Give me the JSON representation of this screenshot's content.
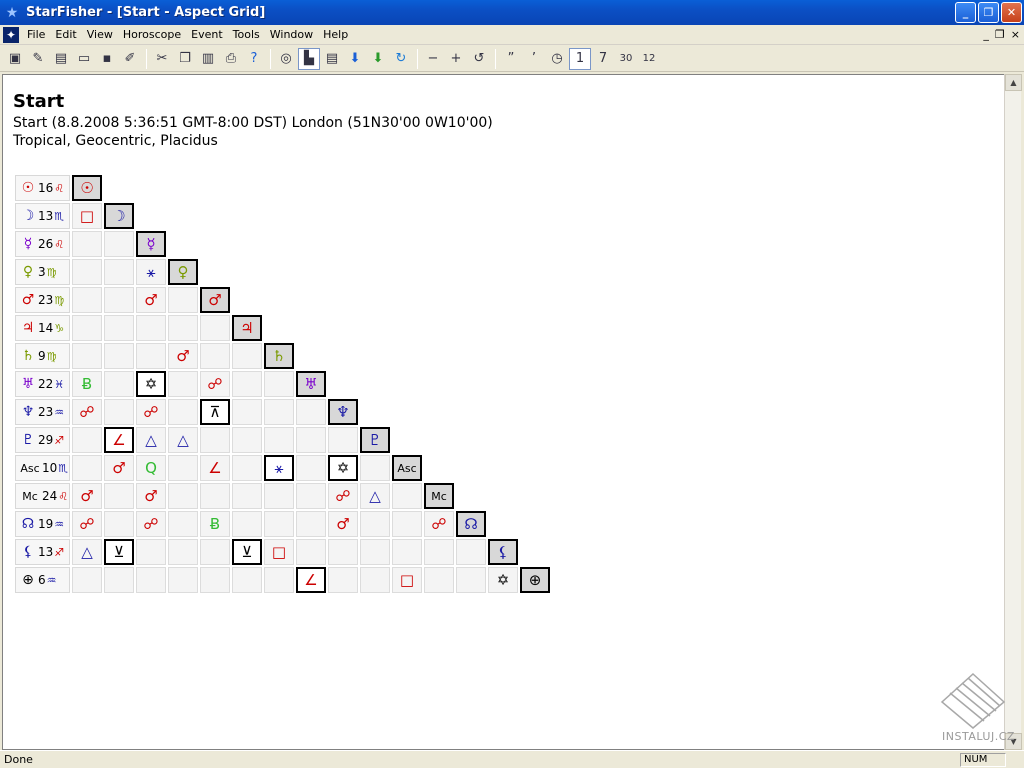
{
  "window": {
    "title": "StarFisher - [Start - Aspect Grid]",
    "app_icon": "star-icon",
    "buttons": {
      "minimize": "_",
      "maximize": "❐",
      "close": "✕"
    }
  },
  "menubar": {
    "items": [
      "File",
      "Edit",
      "View",
      "Horoscope",
      "Event",
      "Tools",
      "Window",
      "Help"
    ],
    "mdi_buttons": {
      "minimize": "_",
      "restore": "❐",
      "close": "×"
    }
  },
  "toolbar": {
    "groups": [
      [
        {
          "icon": "new-chart-icon",
          "glyph": "▣"
        },
        {
          "icon": "search-chart-icon",
          "glyph": "✎"
        },
        {
          "icon": "new-document-icon",
          "glyph": "▤"
        },
        {
          "icon": "open-folder-icon",
          "glyph": "▭"
        },
        {
          "icon": "save-icon",
          "glyph": "▪"
        },
        {
          "icon": "edit-icon",
          "glyph": "✐"
        }
      ],
      [
        {
          "icon": "cut-icon",
          "glyph": "✂"
        },
        {
          "icon": "copy-icon",
          "glyph": "❐"
        },
        {
          "icon": "paste-icon",
          "glyph": "▥"
        },
        {
          "icon": "print-icon",
          "glyph": "⎙"
        },
        {
          "icon": "help-icon",
          "glyph": "?"
        }
      ],
      [
        {
          "icon": "wheel-chart-icon",
          "glyph": "◎"
        },
        {
          "icon": "aspect-grid-icon",
          "glyph": "▙",
          "pressed": true
        },
        {
          "icon": "report-icon",
          "glyph": "▤"
        },
        {
          "icon": "arrow-down-blue-icon",
          "glyph": "⬇"
        },
        {
          "icon": "arrow-down-green-icon",
          "glyph": "⬇"
        },
        {
          "icon": "refresh-icon",
          "glyph": "↻"
        }
      ],
      [
        {
          "icon": "zoom-out-icon",
          "glyph": "−"
        },
        {
          "icon": "zoom-in-icon",
          "glyph": "+"
        },
        {
          "icon": "undo-icon",
          "glyph": "↺"
        }
      ],
      [
        {
          "icon": "step-back-icon",
          "glyph": "”"
        },
        {
          "icon": "step-forward-icon",
          "glyph": "’"
        },
        {
          "icon": "clock-icon",
          "glyph": "◷"
        },
        {
          "icon": "one-day-icon",
          "glyph": "1",
          "pressed": true
        },
        {
          "icon": "seven-days-icon",
          "glyph": "7"
        },
        {
          "icon": "thirty-days-icon",
          "glyph": "30"
        },
        {
          "icon": "twelve-months-icon",
          "glyph": "12"
        }
      ]
    ]
  },
  "header": {
    "title": "Start",
    "line1": "Start (8.8.2008 5:36:51 GMT-8:00 DST) London (51N30'00 0W10'00)",
    "line2": "Tropical, Geocentric, Placidus"
  },
  "aspect_grid": {
    "rows": [
      {
        "planet": "☉",
        "color": "#cc0000",
        "degree": "16",
        "sign": "♌",
        "sign_color": "#cc0000",
        "diag_color": "#cc0000"
      },
      {
        "planet": "☽",
        "color": "#1a1aa6",
        "degree": "13",
        "sign": "♏",
        "sign_color": "#1a1aa6",
        "diag_color": "#1a1aa6"
      },
      {
        "planet": "☿",
        "color": "#7a00cc",
        "degree": "26",
        "sign": "♌",
        "sign_color": "#cc0000",
        "diag_color": "#7a00cc"
      },
      {
        "planet": "♀",
        "color": "#7a9a00",
        "degree": "3",
        "sign": "♍",
        "sign_color": "#7a9a00",
        "diag_color": "#7a9a00"
      },
      {
        "planet": "♂",
        "color": "#cc0000",
        "degree": "23",
        "sign": "♍",
        "sign_color": "#7a9a00",
        "diag_color": "#cc0000"
      },
      {
        "planet": "♃",
        "color": "#cc0000",
        "degree": "14",
        "sign": "♑",
        "sign_color": "#7a9a00",
        "diag_color": "#cc0000"
      },
      {
        "planet": "♄",
        "color": "#7a9a00",
        "degree": "9",
        "sign": "♍",
        "sign_color": "#7a9a00",
        "diag_color": "#7a9a00"
      },
      {
        "planet": "♅",
        "color": "#7a00cc",
        "degree": "22",
        "sign": "♓",
        "sign_color": "#1a1aa6",
        "diag_color": "#7a00cc"
      },
      {
        "planet": "♆",
        "color": "#1a1aa6",
        "degree": "23",
        "sign": "♒",
        "sign_color": "#1a1aa6",
        "diag_color": "#1a1aa6"
      },
      {
        "planet": "♇",
        "color": "#1a1aa6",
        "degree": "29",
        "sign": "♐",
        "sign_color": "#cc0000",
        "diag_color": "#1a1aa6"
      },
      {
        "planet": "Asc",
        "color": "#000000",
        "degree": "10",
        "sign": "♏",
        "sign_color": "#1a1aa6",
        "diag_color": "#000000"
      },
      {
        "planet": "Mc",
        "color": "#000000",
        "degree": "24",
        "sign": "♌",
        "sign_color": "#cc0000",
        "diag_color": "#000000"
      },
      {
        "planet": "☊",
        "color": "#1a1aa6",
        "degree": "19",
        "sign": "♒",
        "sign_color": "#1a1aa6",
        "diag_color": "#1a1aa6"
      },
      {
        "planet": "⚸",
        "color": "#1a1aa6",
        "degree": "13",
        "sign": "♐",
        "sign_color": "#cc0000",
        "diag_color": "#1a1aa6"
      },
      {
        "planet": "⊕",
        "color": "#000000",
        "degree": "6",
        "sign": "♒",
        "sign_color": "#1a1aa6",
        "diag_color": "#000000"
      }
    ],
    "aspects": [
      {
        "row": 1,
        "col": 0,
        "glyph": "□",
        "color": "#cc0000",
        "boxed": false
      },
      {
        "row": 3,
        "col": 2,
        "glyph": "⚹",
        "color": "#1a1aa6",
        "boxed": false
      },
      {
        "row": 4,
        "col": 2,
        "glyph": "♂",
        "color": "#cc0000",
        "boxed": false
      },
      {
        "row": 6,
        "col": 3,
        "glyph": "♂",
        "color": "#cc0000",
        "boxed": false
      },
      {
        "row": 7,
        "col": 0,
        "glyph": "Ƀ",
        "color": "#33bb33",
        "boxed": false
      },
      {
        "row": 7,
        "col": 2,
        "glyph": "✡",
        "color": "#000000",
        "boxed": true
      },
      {
        "row": 7,
        "col": 4,
        "glyph": "☍",
        "color": "#cc0000",
        "boxed": false
      },
      {
        "row": 8,
        "col": 0,
        "glyph": "☍",
        "color": "#cc0000",
        "boxed": false
      },
      {
        "row": 8,
        "col": 2,
        "glyph": "☍",
        "color": "#cc0000",
        "boxed": false
      },
      {
        "row": 8,
        "col": 4,
        "glyph": "⊼",
        "color": "#000000",
        "boxed": true
      },
      {
        "row": 9,
        "col": 1,
        "glyph": "∠",
        "color": "#cc0000",
        "boxed": true
      },
      {
        "row": 9,
        "col": 2,
        "glyph": "△",
        "color": "#1a1aa6",
        "boxed": false
      },
      {
        "row": 9,
        "col": 3,
        "glyph": "△",
        "color": "#1a1aa6",
        "boxed": false
      },
      {
        "row": 10,
        "col": 1,
        "glyph": "♂",
        "color": "#cc0000",
        "boxed": false
      },
      {
        "row": 10,
        "col": 2,
        "glyph": "Q",
        "color": "#33bb33",
        "boxed": false
      },
      {
        "row": 10,
        "col": 4,
        "glyph": "∠",
        "color": "#cc0000",
        "boxed": false
      },
      {
        "row": 10,
        "col": 6,
        "glyph": "⚹",
        "color": "#1a1aa6",
        "boxed": true
      },
      {
        "row": 10,
        "col": 8,
        "glyph": "✡",
        "color": "#000000",
        "boxed": true
      },
      {
        "row": 11,
        "col": 0,
        "glyph": "♂",
        "color": "#cc0000",
        "boxed": false
      },
      {
        "row": 11,
        "col": 2,
        "glyph": "♂",
        "color": "#cc0000",
        "boxed": false
      },
      {
        "row": 11,
        "col": 8,
        "glyph": "☍",
        "color": "#cc0000",
        "boxed": false
      },
      {
        "row": 11,
        "col": 9,
        "glyph": "△",
        "color": "#1a1aa6",
        "boxed": false
      },
      {
        "row": 12,
        "col": 0,
        "glyph": "☍",
        "color": "#cc0000",
        "boxed": false
      },
      {
        "row": 12,
        "col": 2,
        "glyph": "☍",
        "color": "#cc0000",
        "boxed": false
      },
      {
        "row": 12,
        "col": 4,
        "glyph": "Ƀ",
        "color": "#33bb33",
        "boxed": false
      },
      {
        "row": 12,
        "col": 8,
        "glyph": "♂",
        "color": "#cc0000",
        "boxed": false
      },
      {
        "row": 12,
        "col": 11,
        "glyph": "☍",
        "color": "#cc0000",
        "boxed": false
      },
      {
        "row": 13,
        "col": 0,
        "glyph": "△",
        "color": "#1a1aa6",
        "boxed": false
      },
      {
        "row": 13,
        "col": 1,
        "glyph": "⊻",
        "color": "#000000",
        "boxed": true
      },
      {
        "row": 13,
        "col": 5,
        "glyph": "⊻",
        "color": "#000000",
        "boxed": true
      },
      {
        "row": 13,
        "col": 6,
        "glyph": "□",
        "color": "#cc0000",
        "boxed": false
      },
      {
        "row": 14,
        "col": 7,
        "glyph": "∠",
        "color": "#cc0000",
        "boxed": true
      },
      {
        "row": 14,
        "col": 10,
        "glyph": "□",
        "color": "#cc0000",
        "boxed": false
      },
      {
        "row": 14,
        "col": 13,
        "glyph": "✡",
        "color": "#000000",
        "boxed": false
      }
    ]
  },
  "watermark": {
    "text": "INSTALUJ.CZ",
    "icon": "instaluj-logo-icon"
  },
  "statusbar": {
    "text": "Done",
    "num": "NUM"
  }
}
